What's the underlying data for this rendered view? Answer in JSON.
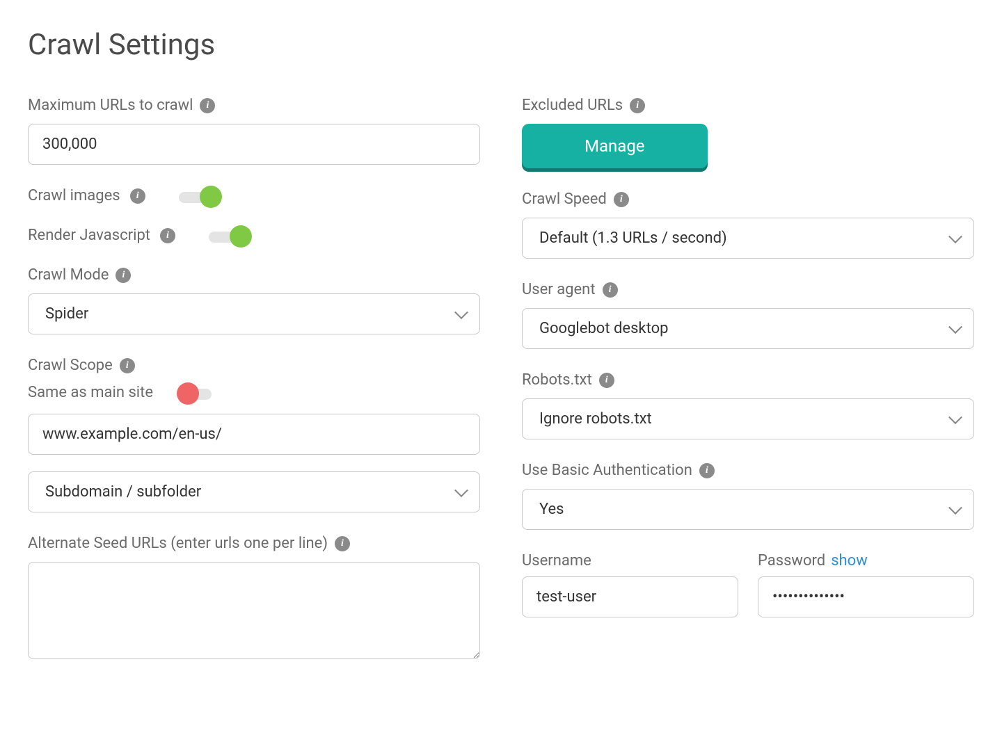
{
  "page_title": "Crawl Settings",
  "left": {
    "max_urls": {
      "label": "Maximum URLs to crawl",
      "value": "300,000"
    },
    "crawl_images": {
      "label": "Crawl images",
      "on": true
    },
    "render_js": {
      "label": "Render Javascript",
      "on": true
    },
    "crawl_mode": {
      "label": "Crawl Mode",
      "value": "Spider"
    },
    "crawl_scope": {
      "label": "Crawl Scope",
      "same_as_main_label": "Same as main site",
      "same_as_main_on": false,
      "url_value": "www.example.com/en-us/",
      "scope_select": "Subdomain / subfolder"
    },
    "alt_seed": {
      "label": "Alternate Seed URLs (enter urls one per line)",
      "value": ""
    }
  },
  "right": {
    "excluded_urls": {
      "label": "Excluded URLs",
      "button": "Manage"
    },
    "crawl_speed": {
      "label": "Crawl Speed",
      "value": "Default (1.3 URLs / second)"
    },
    "user_agent": {
      "label": "User agent",
      "value": "Googlebot desktop"
    },
    "robots": {
      "label": "Robots.txt",
      "value": "Ignore robots.txt"
    },
    "basic_auth": {
      "label": "Use Basic Authentication",
      "value": "Yes"
    },
    "username": {
      "label": "Username",
      "value": "test-user"
    },
    "password": {
      "label": "Password",
      "show_label": "show",
      "value": "••••••••••••••"
    }
  }
}
